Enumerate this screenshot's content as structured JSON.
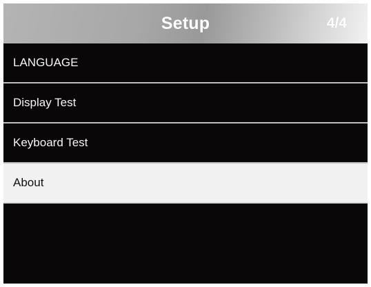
{
  "header": {
    "title": "Setup",
    "page_indicator": "4/4"
  },
  "menu": {
    "items": [
      {
        "label": "LANGUAGE",
        "selected": false
      },
      {
        "label": "Display Test",
        "selected": false
      },
      {
        "label": "Keyboard Test",
        "selected": false
      },
      {
        "label": "About",
        "selected": true
      }
    ]
  },
  "colors": {
    "screen_background": "#0a0708",
    "item_text": "#f5f5f5",
    "selected_background": "#f1f1f1",
    "selected_text": "#111111",
    "separator": "#bfbfbf"
  }
}
